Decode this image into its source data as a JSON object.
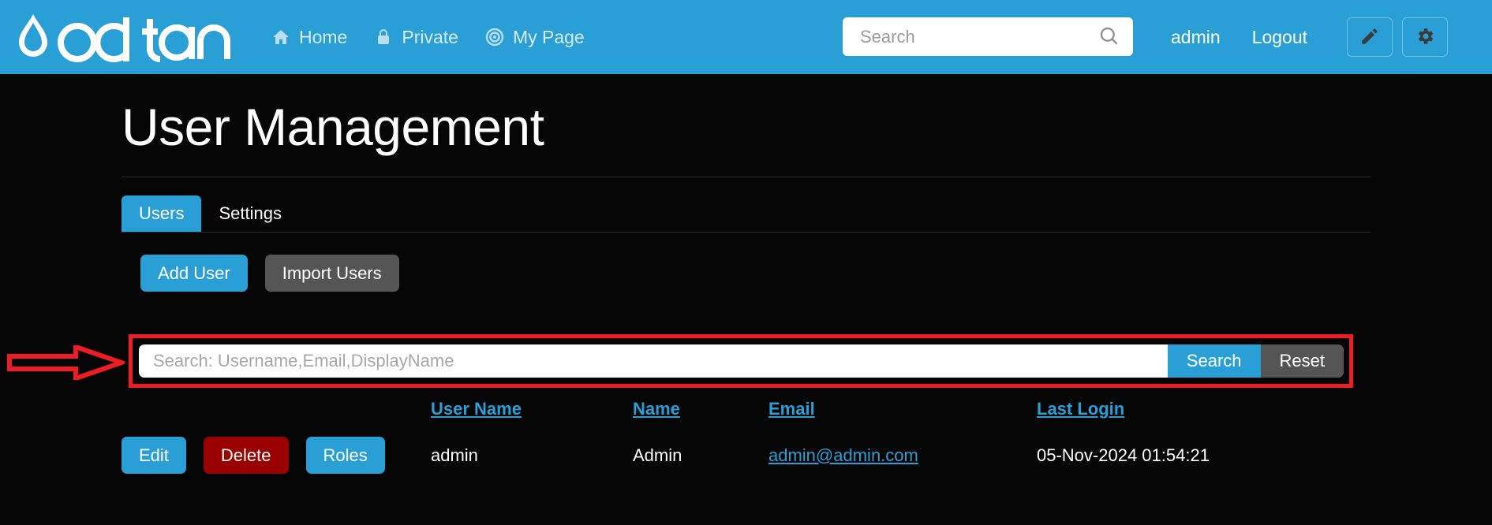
{
  "header": {
    "brand_name": "oqtane",
    "brand_icon": "water-drop-icon",
    "nav": [
      {
        "label": "Home",
        "icon": "home-icon"
      },
      {
        "label": "Private",
        "icon": "lock-icon"
      },
      {
        "label": "My Page",
        "icon": "target-icon"
      }
    ],
    "search": {
      "placeholder": "Search",
      "value": "",
      "icon": "search-icon"
    },
    "user_label": "admin",
    "logout_label": "Logout",
    "edit_icon": "pencil-icon",
    "settings_icon": "gear-icon",
    "bg_color": "#2a9fd6"
  },
  "main": {
    "page_title": "User Management",
    "tabs": [
      {
        "label": "Users",
        "active": true
      },
      {
        "label": "Settings",
        "active": false
      }
    ],
    "actions": [
      {
        "label": "Add User",
        "style": "primary"
      },
      {
        "label": "Import Users",
        "style": "secondary"
      }
    ],
    "search_bar": {
      "placeholder": "Search: Username,Email,DisplayName",
      "value": "",
      "search_label": "Search",
      "reset_label": "Reset"
    },
    "table": {
      "columns": [
        "User Name",
        "Name",
        "Email",
        "Last Login"
      ],
      "row_actions": [
        {
          "label": "Edit",
          "style": "primary"
        },
        {
          "label": "Delete",
          "style": "danger"
        },
        {
          "label": "Roles",
          "style": "primary"
        }
      ],
      "rows": [
        {
          "username": "admin",
          "name": "Admin",
          "email": "admin@admin.com",
          "last_login": "05-Nov-2024 01:54:21"
        }
      ]
    }
  },
  "annotation": {
    "type": "red-arrow-and-box",
    "color": "#ee1c24",
    "points_to": "user-search-input"
  },
  "colors": {
    "accent": "#2a9fd6",
    "background": "#060606",
    "danger": "#9a0000",
    "secondary": "#555555",
    "annotation": "#ee1c24"
  }
}
